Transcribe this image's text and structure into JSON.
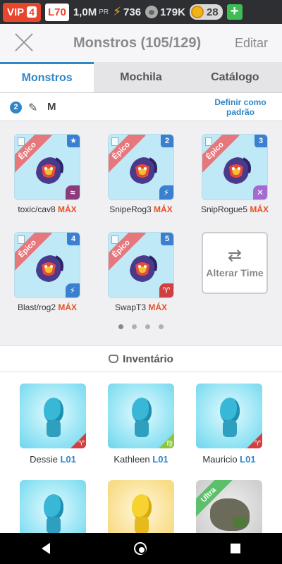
{
  "statusbar": {
    "vip_label": "VIP",
    "vip_level": "4",
    "player_level": "L70",
    "power_value": "1,0M",
    "power_suffix": "PR",
    "energy": "736",
    "food": "179K",
    "coins": "28"
  },
  "header": {
    "title": "Monstros (105/129)",
    "edit_label": "Editar"
  },
  "tabs": [
    {
      "label": "Monstros",
      "active": true
    },
    {
      "label": "Mochila",
      "active": false
    },
    {
      "label": "Catálogo",
      "active": false
    }
  ],
  "filter": {
    "count": "2",
    "size_label": "M",
    "default_link": "Definir como padrão"
  },
  "team": {
    "rarity_label": "Épico",
    "max_label": "MÁX",
    "monsters": [
      {
        "name": "toxic/cav8",
        "slot": "★",
        "element": "≈",
        "element_color": "#8b3c7c"
      },
      {
        "name": "SnipeRog3",
        "slot": "2",
        "element": "⚡",
        "element_color": "#3a7fd0"
      },
      {
        "name": "SnipRogue5",
        "slot": "3",
        "element": "✕",
        "element_color": "#a46ad0"
      },
      {
        "name": "Blast/rog2",
        "slot": "4",
        "element": "⚡",
        "element_color": "#3a7fd0"
      },
      {
        "name": "SwapT3",
        "slot": "5",
        "element": "♈",
        "element_color": "#d04040"
      }
    ],
    "swap_label": "Alterar Time",
    "page_count": 4,
    "active_page": 1
  },
  "inventory": {
    "title": "Inventário",
    "items": [
      {
        "name": "Dessie",
        "level": "L01",
        "type": "blue",
        "corner_color": "#d04040",
        "corner_glyph": "♈"
      },
      {
        "name": "Kathleen",
        "level": "L01",
        "type": "blue",
        "corner_color": "#8cc63f",
        "corner_glyph": "♍"
      },
      {
        "name": "Mauricio",
        "level": "L01",
        "type": "blue",
        "corner_color": "#d04040",
        "corner_glyph": "♈"
      },
      {
        "name": "",
        "level": "",
        "type": "blue",
        "corner_color": "",
        "corner_glyph": ""
      },
      {
        "name": "",
        "level": "",
        "type": "gold",
        "corner_color": "",
        "corner_glyph": ""
      },
      {
        "name": "",
        "level": "",
        "type": "rock",
        "corner_color": "",
        "corner_glyph": "",
        "ribbon": "Ultra"
      }
    ]
  },
  "colors": {
    "accent": "#2f86c8",
    "max_text": "#e2532a",
    "epic_ribbon": "#e8777c",
    "ultra_ribbon": "#5cc06b"
  }
}
